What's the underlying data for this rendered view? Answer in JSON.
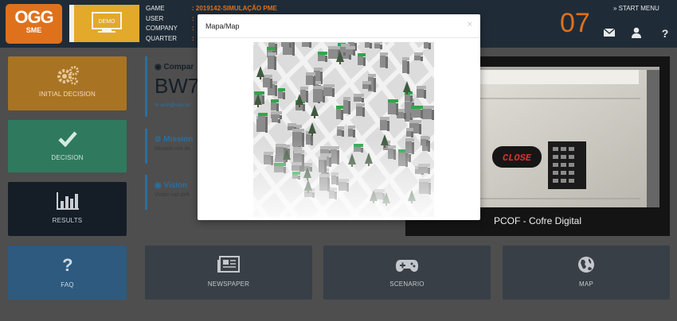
{
  "header": {
    "logo": {
      "main": "OGG",
      "sub": "SME"
    },
    "demo_icon": "demo-monitor-icon",
    "info": [
      {
        "key": "GAME",
        "value": ": 2019142-SIMULAÇÃO PME"
      },
      {
        "key": "USER",
        "value": ": "
      },
      {
        "key": "COMPANY",
        "value": ": "
      },
      {
        "key": "QUARTER",
        "value": ": "
      }
    ],
    "counter": "07",
    "start_menu": "» START MENU",
    "icons": [
      "envelope-icon",
      "user-icon",
      "help-icon"
    ]
  },
  "tiles": {
    "initial_decision": {
      "label": "INITIAL DECISION",
      "icon": "gears-icon"
    },
    "decision": {
      "label": "DECISION",
      "icon": "checkmark-icon"
    },
    "results": {
      "label": "RESULTS",
      "icon": "bar-chart-icon"
    },
    "faq": {
      "label": "FAQ",
      "icon": "question-icon"
    },
    "newspaper": {
      "label": "NEWSPAPER",
      "icon": "newspaper-icon"
    },
    "scenario": {
      "label": "SCENARIO",
      "icon": "gamepad-icon"
    },
    "map": {
      "label": "MAP",
      "icon": "globe-icon"
    }
  },
  "company": {
    "title": "Compar",
    "name": "BW7",
    "email": "abib@ufpr.br",
    "mission_title": "Mission",
    "mission_text": "Mission not de",
    "vision_title": "Vision",
    "vision_text": "Vision not defi"
  },
  "product": {
    "name": "PCOF - Cofre Digital",
    "display_text": "CLOSE"
  },
  "modal": {
    "title": "Mapa/Map",
    "close": "×"
  },
  "colors": {
    "topbar": "#1f2c38",
    "accent_orange": "#e0711c",
    "initial": "#a87423",
    "decision": "#2f7a5e",
    "results": "#151e27",
    "faq": "#2d5a7e",
    "secondary_tiles": "#393f46"
  }
}
